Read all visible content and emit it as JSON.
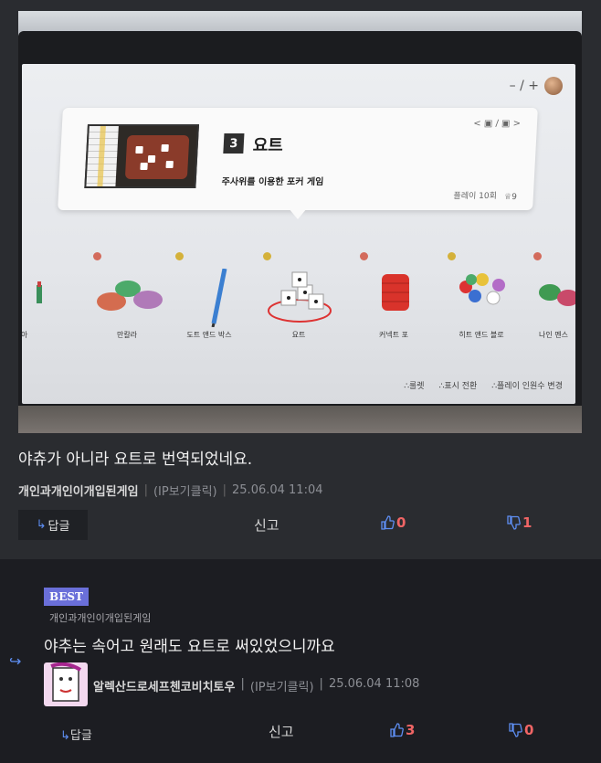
{
  "photo": {
    "tv": {
      "zoom_controls": "– / +",
      "card": {
        "number": "3",
        "title": "요트",
        "description": "주사위를 이용한 포커 게임",
        "nav": "< ▣ / ▣ >",
        "plays": "플레이 10회",
        "trophy": "9"
      },
      "games": [
        {
          "label": "피아",
          "dot": "red"
        },
        {
          "label": "만칼라",
          "dot": "red"
        },
        {
          "label": "도트 앤드 박스",
          "dot": "gold"
        },
        {
          "label": "요트",
          "dot": "gold"
        },
        {
          "label": "커넥트 포",
          "dot": "red"
        },
        {
          "label": "히트 앤드 블로",
          "dot": "gold"
        },
        {
          "label": "나인 멘스",
          "dot": "red"
        }
      ],
      "bottom_hints": [
        "룰렛",
        "표시 전환",
        "플레이 인원수 변경"
      ]
    }
  },
  "comment": {
    "text": "야츄가 아니라 요트로 번역되었네요.",
    "author": "개인과개인이개입된게임",
    "ip": "(IP보기클릭)",
    "datetime": "25.06.04 11:04",
    "reply_label": "답글",
    "report_label": "신고",
    "likes": "0",
    "dislikes": "1"
  },
  "reply": {
    "badge": "BEST",
    "target": "개인과개인이개입된게임",
    "text": "야추는 속어고 원래도 요트로 써있었으니까요",
    "author": "알렉산드로세프첸코비치토우",
    "ip": "(IP보기클릭)",
    "datetime": "25.06.04 11:08",
    "reply_label": "답글",
    "report_label": "신고",
    "likes": "3",
    "dislikes": "0"
  },
  "colors": {
    "background": "#2a2c30",
    "reply_background": "#1c1d22",
    "accent_blue": "#5e8ef2",
    "badge": "#6a6fd9",
    "red": "#f06565"
  }
}
